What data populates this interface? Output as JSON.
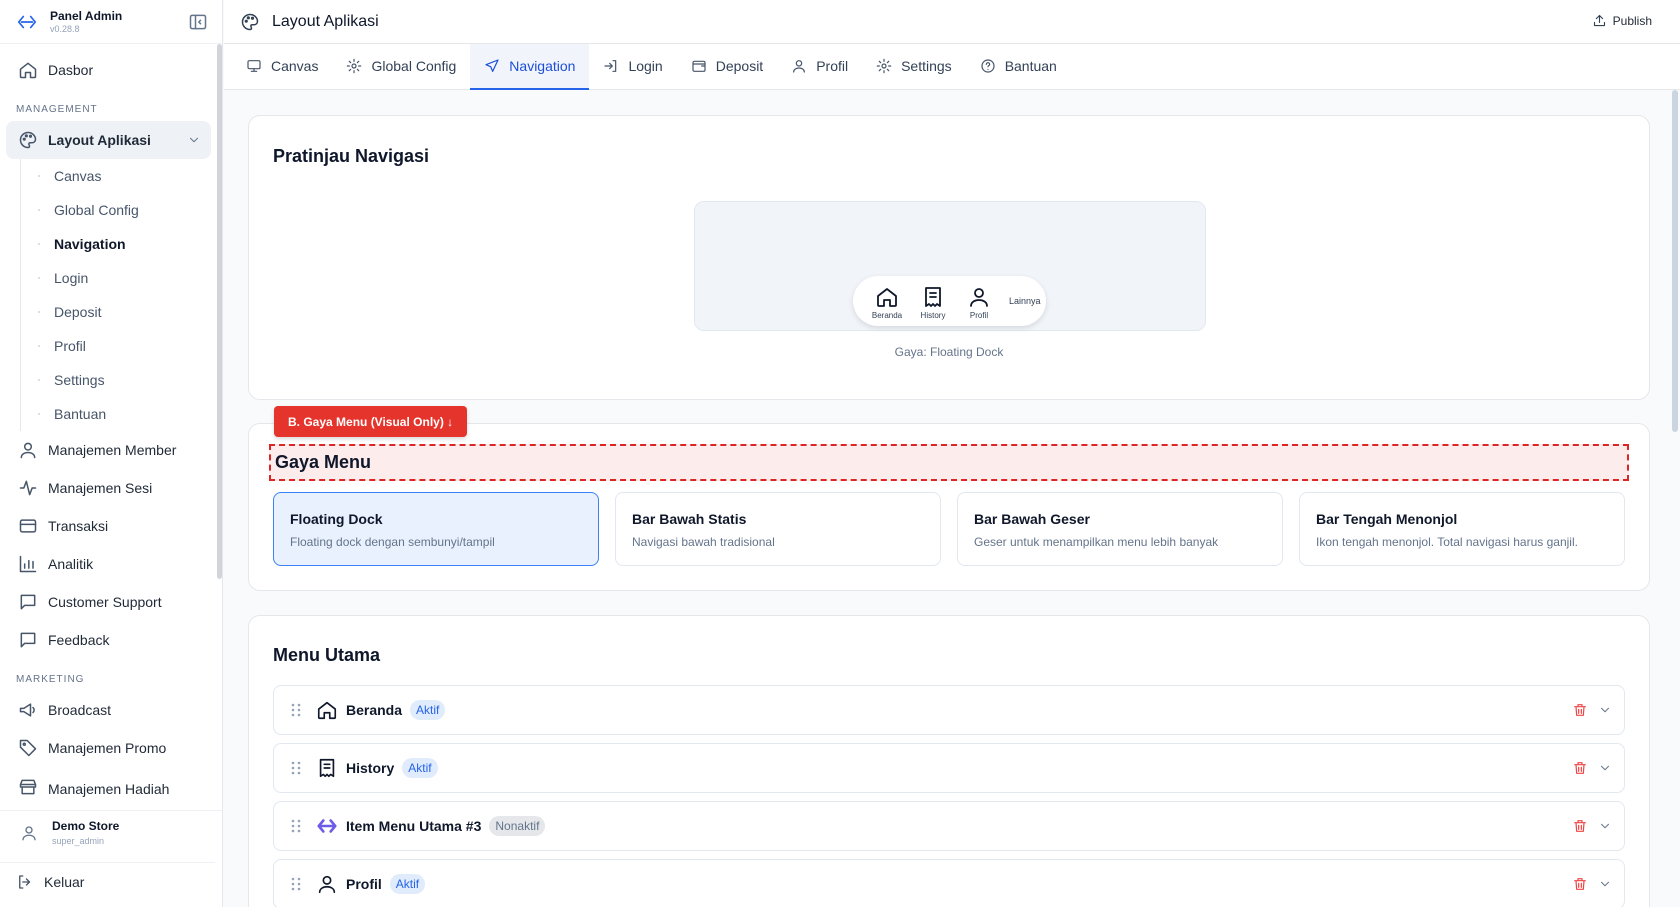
{
  "brand": {
    "name": "Panel Admin",
    "version": "v0.28.8"
  },
  "sidebar": {
    "dashboard": "Dasbor",
    "section_management": "MANAGEMENT",
    "layout_label": "Layout Aplikasi",
    "sub_items": [
      "Canvas",
      "Global Config",
      "Navigation",
      "Login",
      "Deposit",
      "Profil",
      "Settings",
      "Bantuan"
    ],
    "items": [
      {
        "label": "Manajemen Member",
        "icon": "user-icon"
      },
      {
        "label": "Manajemen Sesi",
        "icon": "activity-icon"
      },
      {
        "label": "Transaksi",
        "icon": "credit-card-icon"
      },
      {
        "label": "Analitik",
        "icon": "bar-chart-icon"
      },
      {
        "label": "Customer Support",
        "icon": "message-icon"
      },
      {
        "label": "Feedback",
        "icon": "message-icon"
      }
    ],
    "section_marketing": "MARKETING",
    "marketing_items": [
      {
        "label": "Broadcast",
        "icon": "megaphone-icon"
      },
      {
        "label": "Manajemen Promo",
        "icon": "tag-icon"
      },
      {
        "label": "Manajemen Hadiah",
        "icon": "store-icon"
      }
    ],
    "user": {
      "name": "Demo Store",
      "role": "super_admin"
    },
    "logout": "Keluar"
  },
  "header": {
    "title": "Layout Aplikasi",
    "publish": "Publish"
  },
  "tabs": [
    {
      "label": "Canvas",
      "icon": "monitor-icon"
    },
    {
      "label": "Global Config",
      "icon": "gear-icon"
    },
    {
      "label": "Navigation",
      "icon": "send-icon"
    },
    {
      "label": "Login",
      "icon": "login-icon"
    },
    {
      "label": "Deposit",
      "icon": "wallet-icon"
    },
    {
      "label": "Profil",
      "icon": "user-icon"
    },
    {
      "label": "Settings",
      "icon": "gear-icon"
    },
    {
      "label": "Bantuan",
      "icon": "help-icon"
    }
  ],
  "active_tab": "Navigation",
  "preview": {
    "title": "Pratinjau Navigasi",
    "dock": [
      "Beranda",
      "History",
      "Profil"
    ],
    "more": "Lainnya",
    "caption": "Gaya: Floating Dock"
  },
  "menu_style": {
    "tag": "B. Gaya Menu (Visual Only) ↓",
    "title": "Gaya Menu",
    "options": [
      {
        "title": "Floating Dock",
        "desc": "Floating dock dengan sembunyi/tampil",
        "selected": true
      },
      {
        "title": "Bar Bawah Statis",
        "desc": "Navigasi bawah tradisional",
        "selected": false
      },
      {
        "title": "Bar Bawah Geser",
        "desc": "Geser untuk menampilkan menu lebih banyak",
        "selected": false
      },
      {
        "title": "Bar Tengah Menonjol",
        "desc": "Ikon tengah menonjol. Total navigasi harus ganjil.",
        "selected": false
      }
    ]
  },
  "main_menu": {
    "title": "Menu Utama",
    "rows": [
      {
        "label": "Beranda",
        "status": "Aktif",
        "icon": "home-icon"
      },
      {
        "label": "History",
        "status": "Aktif",
        "icon": "receipt-icon"
      },
      {
        "label": "Item Menu Utama #3",
        "status": "Nonaktif",
        "icon": "app-logo-icon"
      },
      {
        "label": "Profil",
        "status": "Aktif",
        "icon": "user-icon"
      }
    ]
  },
  "colors": {
    "accent": "#2563eb",
    "danger": "#ef4444",
    "tag": "#e5342b"
  }
}
